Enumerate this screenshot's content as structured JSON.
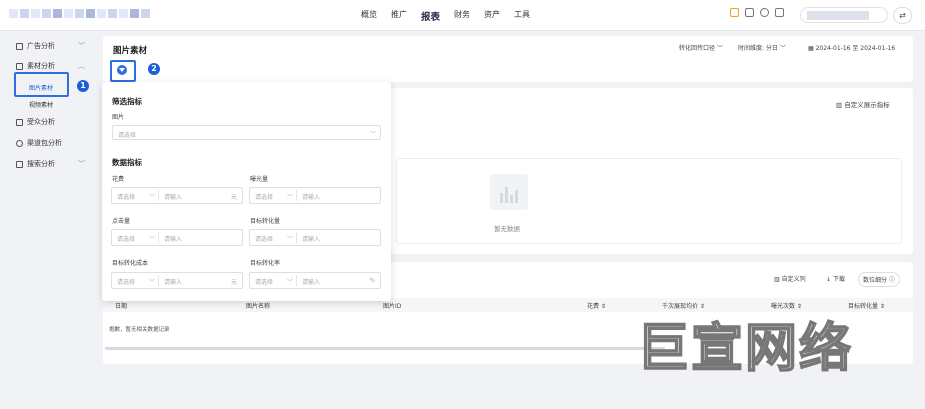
{
  "nav": {
    "items": [
      "概览",
      "推广",
      "报表",
      "财务",
      "资产",
      "工具"
    ],
    "active_index": 2
  },
  "sidebar": {
    "items": [
      {
        "label": "广告分析",
        "icon": "chart-icon",
        "chevron": "﹀"
      },
      {
        "label": "素材分析",
        "icon": "image-icon",
        "chevron": "︿"
      },
      {
        "label": "受众分析",
        "icon": "audience-icon"
      },
      {
        "label": "渠道包分析",
        "icon": "package-icon"
      },
      {
        "label": "搜索分析",
        "icon": "search-icon",
        "chevron": "﹀"
      }
    ],
    "sub_items": [
      "图片素材",
      "视频素材"
    ]
  },
  "annotations": {
    "badge1": "1",
    "badge2": "2"
  },
  "page": {
    "title": "图片素材",
    "conversion": "转化回传口径",
    "granularity": "时间维度: 分日",
    "date_range": "2024-01-16 至 2024-01-16",
    "custom_metrics": "自定义展示指标",
    "empty_text": "暂无数据",
    "tbl_toolbar": [
      "自定义列",
      "下载",
      "数位细分"
    ],
    "table_headers": [
      "日期",
      "图片名称",
      "图片ID",
      "花费 ⇕",
      "千次展现均价 ⇕",
      "曝光次数 ⇕",
      "目标转化量 ⇕"
    ],
    "table_empty": "抱歉，暂无相关数据记录"
  },
  "filter_panel": {
    "section1": "筛选指标",
    "image_label": "图片",
    "image_placeholder": "请选择",
    "section2": "数据指标",
    "select_ph": "请选择",
    "input_ph": "请输入",
    "fields": [
      {
        "label": "花费",
        "unit": "元"
      },
      {
        "label": "曝光量",
        "unit": ""
      },
      {
        "label": "点击量",
        "unit": ""
      },
      {
        "label": "目标转化量",
        "unit": ""
      },
      {
        "label": "目标转化成本",
        "unit": "元"
      },
      {
        "label": "目标转化率",
        "unit": "%"
      }
    ]
  },
  "watermark": "巨宣网络",
  "colors": {
    "accent": "#2b6fe0",
    "highlight_border": "#2e6fe0",
    "badge": "#1a5fd7"
  }
}
